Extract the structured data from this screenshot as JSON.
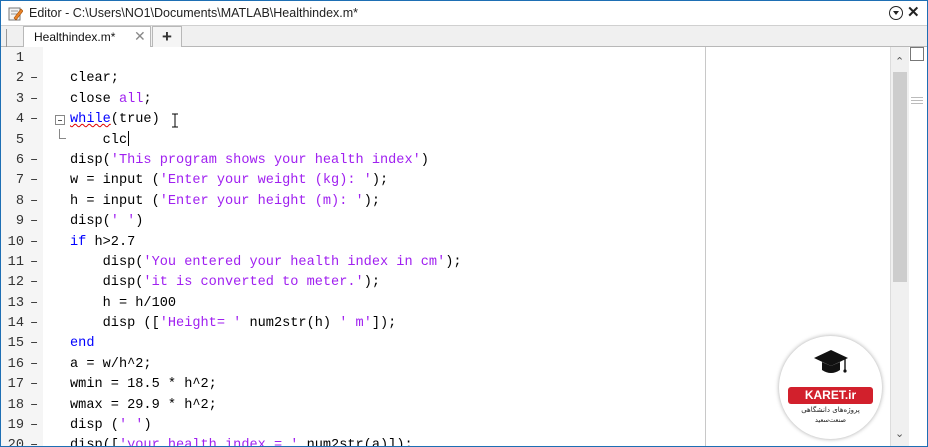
{
  "window": {
    "title": "Editor - C:\\Users\\NO1\\Documents\\MATLAB\\Healthindex.m*",
    "close_glyph": "✕",
    "menu_icon": "chevron-down-circle-icon"
  },
  "tabs": [
    {
      "label": "Healthindex.m*",
      "close_glyph": "✕"
    }
  ],
  "add_tab_glyph": "+",
  "editor": {
    "lines": [
      {
        "n": "1",
        "dash": "",
        "tokens": []
      },
      {
        "n": "2",
        "dash": "–",
        "tokens": [
          {
            "t": "clear;",
            "c": "plain"
          }
        ]
      },
      {
        "n": "3",
        "dash": "–",
        "tokens": [
          {
            "t": "close ",
            "c": "plain"
          },
          {
            "t": "all",
            "c": "str"
          },
          {
            "t": ";",
            "c": "plain"
          }
        ]
      },
      {
        "n": "4",
        "dash": "–",
        "fold": "start",
        "tokens": [
          {
            "t": "while",
            "c": "kw squiggle"
          },
          {
            "t": "(true)",
            "c": "plain"
          }
        ]
      },
      {
        "n": "5",
        "dash": "",
        "fold": "end",
        "cursor": true,
        "tokens": [
          {
            "t": "    clc",
            "c": "plain"
          }
        ]
      },
      {
        "n": "6",
        "dash": "–",
        "tokens": [
          {
            "t": "disp(",
            "c": "plain"
          },
          {
            "t": "'This program shows your health index'",
            "c": "str"
          },
          {
            "t": ")",
            "c": "plain"
          }
        ]
      },
      {
        "n": "7",
        "dash": "–",
        "tokens": [
          {
            "t": "w = input (",
            "c": "plain"
          },
          {
            "t": "'Enter your weight (kg): '",
            "c": "str"
          },
          {
            "t": ");",
            "c": "plain"
          }
        ]
      },
      {
        "n": "8",
        "dash": "–",
        "tokens": [
          {
            "t": "h = input (",
            "c": "plain"
          },
          {
            "t": "'Enter your height (m): '",
            "c": "str"
          },
          {
            "t": ");",
            "c": "plain"
          }
        ]
      },
      {
        "n": "9",
        "dash": "–",
        "tokens": [
          {
            "t": "disp(",
            "c": "plain"
          },
          {
            "t": "' '",
            "c": "str"
          },
          {
            "t": ")",
            "c": "plain"
          }
        ]
      },
      {
        "n": "10",
        "dash": "–",
        "tokens": [
          {
            "t": "if",
            "c": "kw"
          },
          {
            "t": " h>2.7",
            "c": "plain"
          }
        ]
      },
      {
        "n": "11",
        "dash": "–",
        "tokens": [
          {
            "t": "    disp(",
            "c": "plain"
          },
          {
            "t": "'You entered your health index in cm'",
            "c": "str"
          },
          {
            "t": ");",
            "c": "plain"
          }
        ]
      },
      {
        "n": "12",
        "dash": "–",
        "tokens": [
          {
            "t": "    disp(",
            "c": "plain"
          },
          {
            "t": "'it is converted to meter.'",
            "c": "str"
          },
          {
            "t": ");",
            "c": "plain"
          }
        ]
      },
      {
        "n": "13",
        "dash": "–",
        "tokens": [
          {
            "t": "    h = h/100",
            "c": "plain"
          }
        ]
      },
      {
        "n": "14",
        "dash": "–",
        "tokens": [
          {
            "t": "    disp ([",
            "c": "plain"
          },
          {
            "t": "'Height= '",
            "c": "str"
          },
          {
            "t": " num2str(h) ",
            "c": "plain"
          },
          {
            "t": "' m'",
            "c": "str"
          },
          {
            "t": "]);",
            "c": "plain"
          }
        ]
      },
      {
        "n": "15",
        "dash": "–",
        "tokens": [
          {
            "t": "end",
            "c": "kw"
          }
        ]
      },
      {
        "n": "16",
        "dash": "–",
        "tokens": [
          {
            "t": "a = w/h^2;",
            "c": "plain"
          }
        ]
      },
      {
        "n": "17",
        "dash": "–",
        "tokens": [
          {
            "t": "wmin = 18.5 * h^2;",
            "c": "plain"
          }
        ]
      },
      {
        "n": "18",
        "dash": "–",
        "tokens": [
          {
            "t": "wmax = 29.9 * h^2;",
            "c": "plain"
          }
        ]
      },
      {
        "n": "19",
        "dash": "–",
        "tokens": [
          {
            "t": "disp (",
            "c": "plain"
          },
          {
            "t": "' '",
            "c": "str"
          },
          {
            "t": ")",
            "c": "plain"
          }
        ]
      },
      {
        "n": "20",
        "dash": "–",
        "tokens": [
          {
            "t": "disp([",
            "c": "plain"
          },
          {
            "t": "'your health index = '",
            "c": "str"
          },
          {
            "t": " num2str(a)]);",
            "c": "plain"
          }
        ]
      }
    ]
  },
  "scrollbar": {
    "up_glyph": "⌃",
    "down_glyph": "⌄"
  },
  "watermark": {
    "brand": "KARET.ir",
    "line1": "پروژه‌های دانشگاهی",
    "line2": "صنعت‌سعید"
  }
}
